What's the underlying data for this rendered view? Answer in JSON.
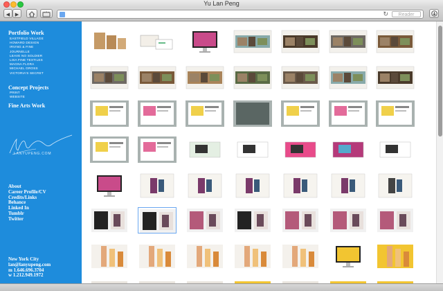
{
  "window": {
    "title": "Yu Lan Peng"
  },
  "toolbar": {
    "url_value": "",
    "reader_label": "Reader",
    "back_label": "◀",
    "forward_label": "▶",
    "reload_glyph": "↻"
  },
  "sidebar": {
    "portfolio_heading": "Portfolio Work",
    "portfolio_items": [
      "EASTFIELD VILLAGE",
      "HOWARD DESIGN",
      "IRVING & FINE",
      "JOURNELLE",
      "LEAVE NO SOLDIER",
      "LISA FINE TEXTILES",
      "MAGNA FLORA",
      "MICHAEL GROSS",
      "VICTORIA'S SECRET"
    ],
    "concept_heading": "Concept Projects",
    "concept_items": [
      "PRINT",
      "WEBSITE"
    ],
    "fine_arts_heading": "Fine Arts Work",
    "logo_text": "LANYUPENG.COM",
    "nav_links": [
      "About",
      "Career Profile/CV",
      "Credits/Links",
      "Behance",
      "Linked In",
      "Tumblr",
      "Twitter"
    ],
    "contact": [
      "New York City",
      "lan@lanyupeng.com",
      "m 1.646.696.3704",
      "w 1.212.949.1972"
    ]
  },
  "colors": {
    "sidebar": "#1e8cdc",
    "page": "#ffffff"
  },
  "thumbnails": [
    "kraft packaging boxes",
    "business card stationery",
    "desktop monitor website",
    "website layout",
    "website layout",
    "website layout",
    "website layout",
    "website layout",
    "website layout",
    "website layout",
    "website layout",
    "website layout",
    "website layout",
    "website layout",
    "gray website frame",
    "collage website",
    "photo grid website",
    "dark website",
    "text website",
    "text website",
    "cosmetics website",
    "book spread",
    "gray frame website",
    "green card",
    "stationery set",
    "pink business cards",
    "colorful cards",
    "black white packaging",
    "desktop monitor website",
    "lace website",
    "fashion website",
    "fashion website",
    "fashion website",
    "fashion website",
    "photograph print",
    "black white prints",
    "black white photo spread",
    "magazine spread",
    "magazine spread",
    "lingerie spread",
    "lingerie spread",
    "lingerie spread",
    "magazine spread",
    "product packaging",
    "product packaging",
    "product packaging",
    "product packaging",
    "desktop monitor website",
    "yellow website"
  ]
}
